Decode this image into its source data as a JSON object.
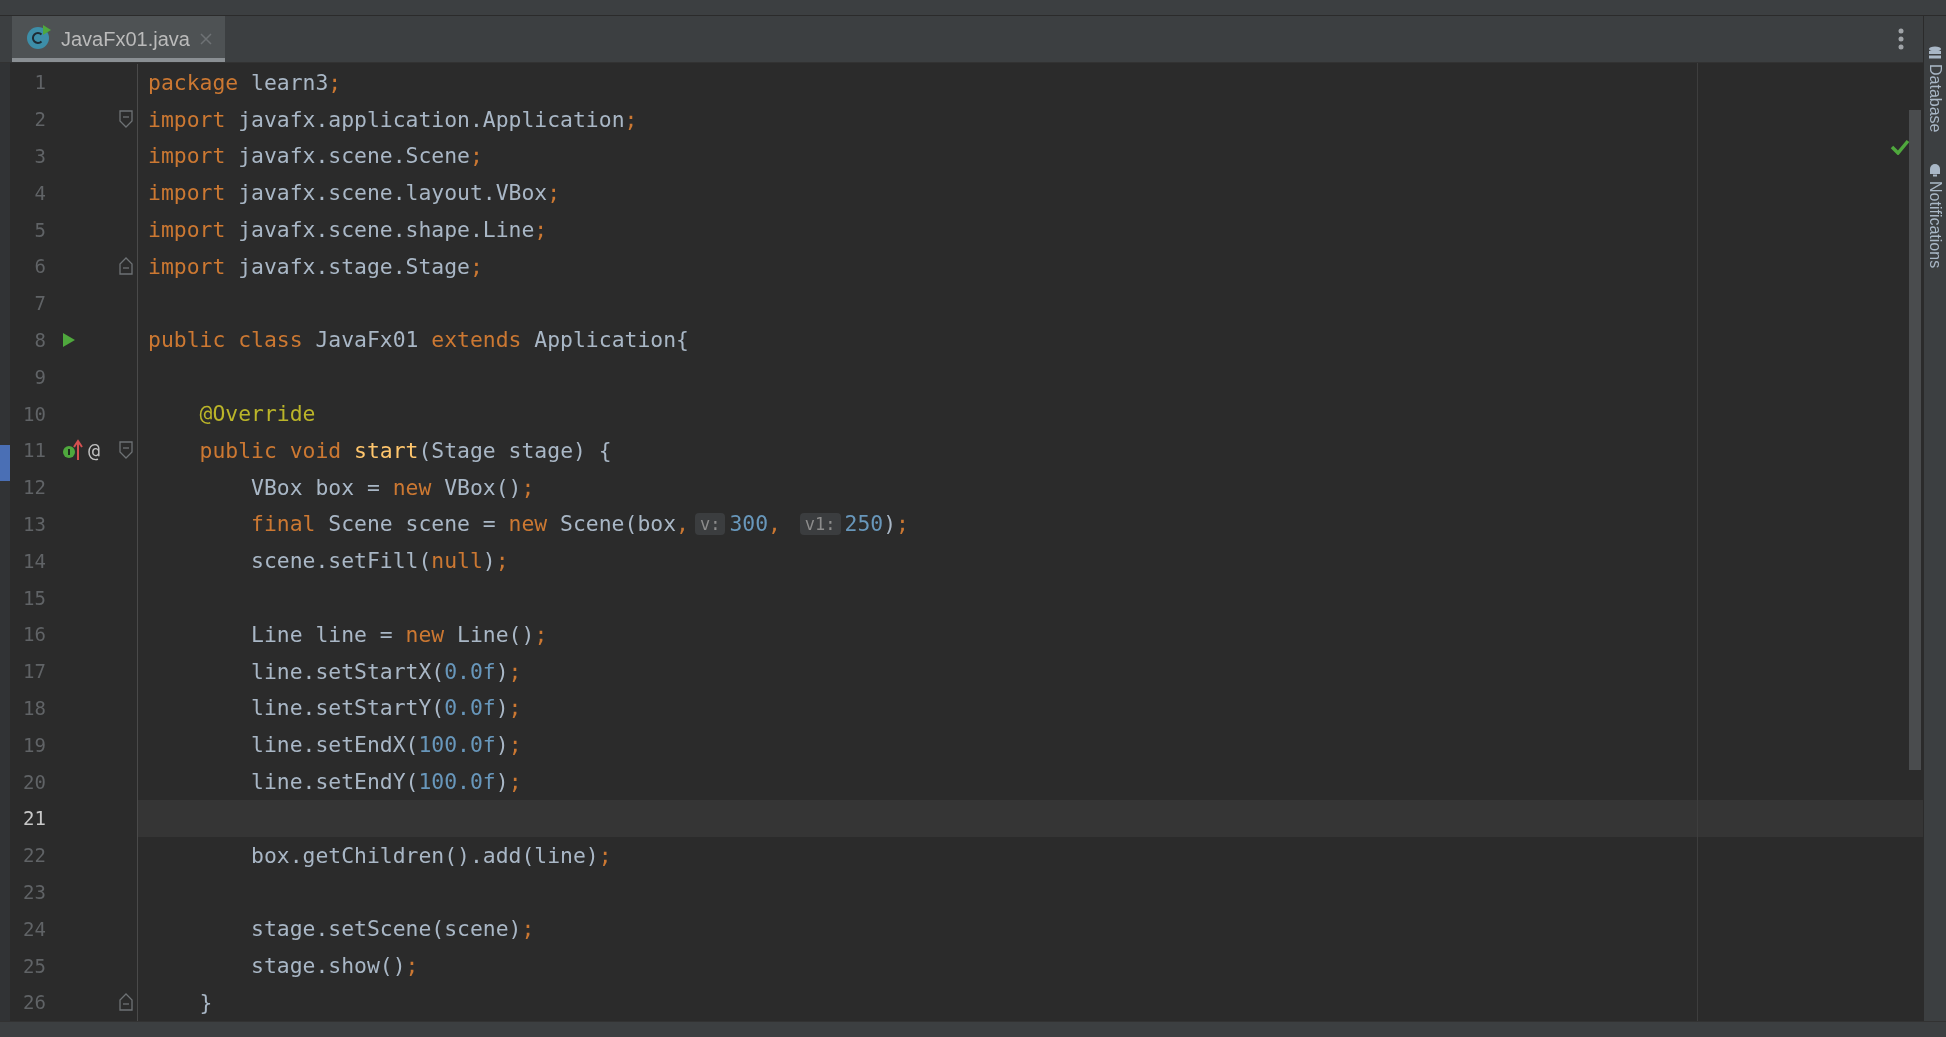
{
  "tab": {
    "title": "JavaFx01.java",
    "selected": true
  },
  "lines": [
    {
      "number": "1",
      "current": false,
      "tokens": [
        {
          "kind": "kw",
          "text": "package "
        },
        {
          "kind": "plain",
          "text": "learn3"
        },
        {
          "kind": "kw",
          "text": ";"
        }
      ]
    },
    {
      "number": "2",
      "current": false,
      "fold": {
        "kind": "start"
      },
      "tokens": [
        {
          "kind": "kw",
          "text": "import "
        },
        {
          "kind": "plain",
          "text": "javafx.application.Application"
        },
        {
          "kind": "kw",
          "text": ";"
        }
      ]
    },
    {
      "number": "3",
      "current": false,
      "tokens": [
        {
          "kind": "kw",
          "text": "import "
        },
        {
          "kind": "plain",
          "text": "javafx.scene.Scene"
        },
        {
          "kind": "kw",
          "text": ";"
        }
      ]
    },
    {
      "number": "4",
      "current": false,
      "tokens": [
        {
          "kind": "kw",
          "text": "import "
        },
        {
          "kind": "plain",
          "text": "javafx.scene.layout.VBox"
        },
        {
          "kind": "kw",
          "text": ";"
        }
      ]
    },
    {
      "number": "5",
      "current": false,
      "tokens": [
        {
          "kind": "kw",
          "text": "import "
        },
        {
          "kind": "plain",
          "text": "javafx.scene.shape.Line"
        },
        {
          "kind": "kw",
          "text": ";"
        }
      ]
    },
    {
      "number": "6",
      "current": false,
      "fold": {
        "kind": "end"
      },
      "tokens": [
        {
          "kind": "kw",
          "text": "import "
        },
        {
          "kind": "plain",
          "text": "javafx.stage.Stage"
        },
        {
          "kind": "kw",
          "text": ";"
        }
      ]
    },
    {
      "number": "7",
      "current": false
    },
    {
      "number": "8",
      "current": false,
      "gutter": [
        {
          "kind": "run"
        }
      ],
      "tokens": [
        {
          "kind": "kw",
          "text": "public class "
        },
        {
          "kind": "plain",
          "text": "JavaFx01 "
        },
        {
          "kind": "kw",
          "text": "extends "
        },
        {
          "kind": "plain",
          "text": "Application{"
        }
      ]
    },
    {
      "number": "9",
      "current": false
    },
    {
      "number": "10",
      "current": false,
      "tokens": [
        {
          "kind": "annotation",
          "text": "    @Override"
        }
      ]
    },
    {
      "number": "11",
      "current": false,
      "fold": {
        "kind": "start"
      },
      "gutter": [
        {
          "kind": "implements"
        },
        {
          "kind": "text",
          "text": "@"
        }
      ],
      "tokens": [
        {
          "kind": "kw",
          "text": "    public void "
        },
        {
          "kind": "method",
          "text": "start"
        },
        {
          "kind": "plain",
          "text": "(Stage stage) {"
        }
      ]
    },
    {
      "number": "12",
      "current": false,
      "tokens": [
        {
          "kind": "plain",
          "text": "        VBox box = "
        },
        {
          "kind": "kw",
          "text": "new "
        },
        {
          "kind": "plain",
          "text": "VBox()"
        },
        {
          "kind": "kw",
          "text": ";"
        }
      ]
    },
    {
      "number": "13",
      "current": false,
      "tokens": [
        {
          "kind": "kw",
          "text": "        final "
        },
        {
          "kind": "plain",
          "text": "Scene scene = "
        },
        {
          "kind": "kw",
          "text": "new "
        },
        {
          "kind": "plain",
          "text": "Scene(box"
        },
        {
          "kind": "kw",
          "text": ","
        },
        {
          "kind": "hint",
          "text": "v:"
        },
        {
          "kind": "num",
          "text": "300"
        },
        {
          "kind": "kw",
          "text": ", "
        },
        {
          "kind": "hint",
          "text": "v1:"
        },
        {
          "kind": "num",
          "text": "250"
        },
        {
          "kind": "plain",
          "text": ")"
        },
        {
          "kind": "kw",
          "text": ";"
        }
      ]
    },
    {
      "number": "14",
      "current": false,
      "tokens": [
        {
          "kind": "plain",
          "text": "        scene.setFill("
        },
        {
          "kind": "kw",
          "text": "null"
        },
        {
          "kind": "plain",
          "text": ")"
        },
        {
          "kind": "kw",
          "text": ";"
        }
      ]
    },
    {
      "number": "15",
      "current": false
    },
    {
      "number": "16",
      "current": false,
      "tokens": [
        {
          "kind": "plain",
          "text": "        Line line = "
        },
        {
          "kind": "kw",
          "text": "new "
        },
        {
          "kind": "plain",
          "text": "Line()"
        },
        {
          "kind": "kw",
          "text": ";"
        }
      ]
    },
    {
      "number": "17",
      "current": false,
      "tokens": [
        {
          "kind": "plain",
          "text": "        line.setStartX("
        },
        {
          "kind": "num",
          "text": "0.0f"
        },
        {
          "kind": "plain",
          "text": ")"
        },
        {
          "kind": "kw",
          "text": ";"
        }
      ]
    },
    {
      "number": "18",
      "current": false,
      "tokens": [
        {
          "kind": "plain",
          "text": "        line.setStartY("
        },
        {
          "kind": "num",
          "text": "0.0f"
        },
        {
          "kind": "plain",
          "text": ")"
        },
        {
          "kind": "kw",
          "text": ";"
        }
      ]
    },
    {
      "number": "19",
      "current": false,
      "tokens": [
        {
          "kind": "plain",
          "text": "        line.setEndX("
        },
        {
          "kind": "num",
          "text": "100.0f"
        },
        {
          "kind": "plain",
          "text": ")"
        },
        {
          "kind": "kw",
          "text": ";"
        }
      ]
    },
    {
      "number": "20",
      "current": false,
      "tokens": [
        {
          "kind": "plain",
          "text": "        line.setEndY("
        },
        {
          "kind": "num",
          "text": "100.0f"
        },
        {
          "kind": "plain",
          "text": ")"
        },
        {
          "kind": "kw",
          "text": ";"
        }
      ]
    },
    {
      "number": "21",
      "current": true
    },
    {
      "number": "22",
      "current": false,
      "tokens": [
        {
          "kind": "plain",
          "text": "        box.getChildren().add(line)"
        },
        {
          "kind": "kw",
          "text": ";"
        }
      ]
    },
    {
      "number": "23",
      "current": false
    },
    {
      "number": "24",
      "current": false,
      "tokens": [
        {
          "kind": "plain",
          "text": "        stage.setScene(scene)"
        },
        {
          "kind": "kw",
          "text": ";"
        }
      ]
    },
    {
      "number": "25",
      "current": false,
      "tokens": [
        {
          "kind": "plain",
          "text": "        stage.show()"
        },
        {
          "kind": "kw",
          "text": ";"
        }
      ]
    },
    {
      "number": "26",
      "current": false,
      "fold": {
        "kind": "end"
      },
      "tokens": [
        {
          "kind": "plain",
          "text": "    }"
        }
      ]
    }
  ],
  "side_panel": [
    {
      "kind": "database",
      "label": "Database"
    },
    {
      "kind": "notifications",
      "label": "Notifications"
    }
  ]
}
